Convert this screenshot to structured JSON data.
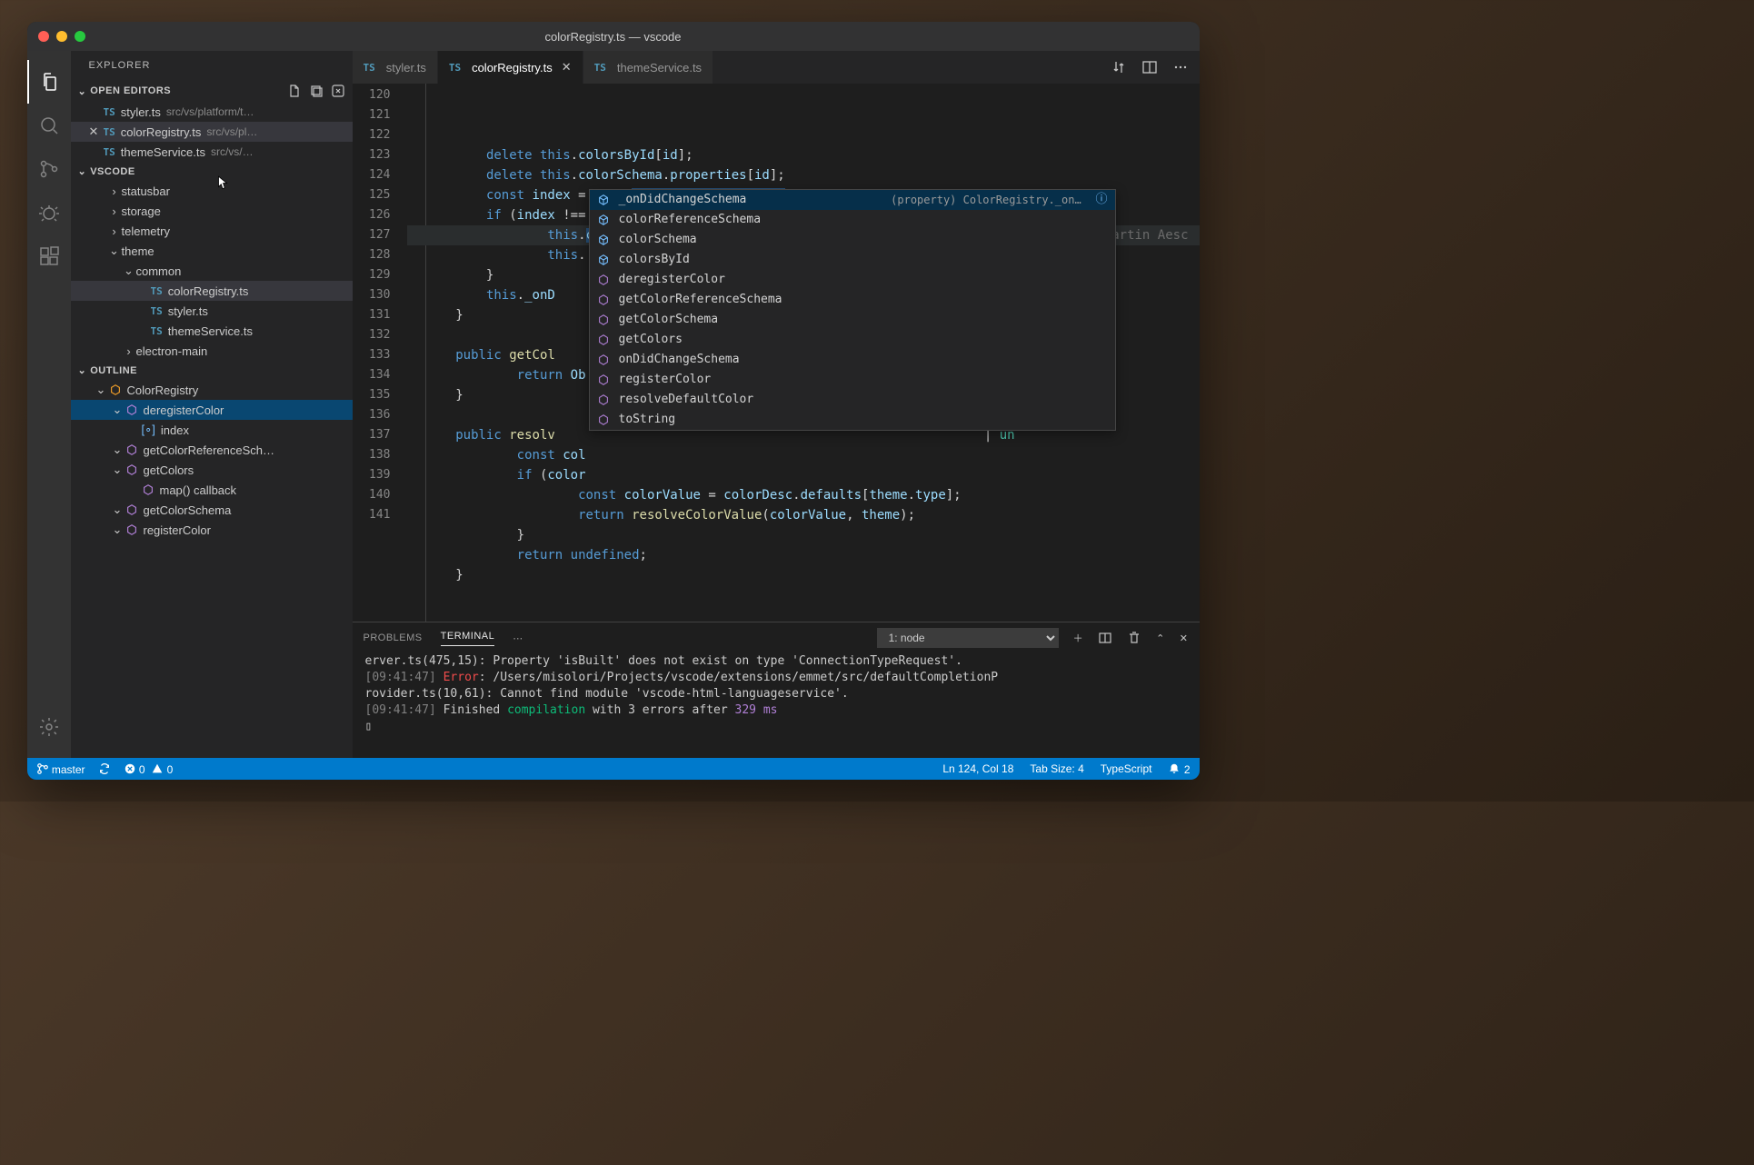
{
  "title": "colorRegistry.ts — vscode",
  "explorer": {
    "title": "EXPLORER"
  },
  "sections": {
    "open_editors": "OPEN EDITORS",
    "workspace": "VSCODE",
    "outline": "OUTLINE"
  },
  "open_editors": [
    {
      "name": "styler.ts",
      "path": "src/vs/platform/t…",
      "active": false
    },
    {
      "name": "colorRegistry.ts",
      "path": "src/vs/pl…",
      "active": true
    },
    {
      "name": "themeService.ts",
      "path": "src/vs/…",
      "active": false
    }
  ],
  "tree": [
    {
      "depth": 2,
      "chev": "›",
      "name": "statusbar"
    },
    {
      "depth": 2,
      "chev": "›",
      "name": "storage"
    },
    {
      "depth": 2,
      "chev": "›",
      "name": "telemetry"
    },
    {
      "depth": 2,
      "chev": "⌄",
      "name": "theme"
    },
    {
      "depth": 3,
      "chev": "⌄",
      "name": "common"
    },
    {
      "depth": 4,
      "chev": "",
      "name": "colorRegistry.ts",
      "ts": true,
      "selected": true
    },
    {
      "depth": 4,
      "chev": "",
      "name": "styler.ts",
      "ts": true
    },
    {
      "depth": 4,
      "chev": "",
      "name": "themeService.ts",
      "ts": true
    },
    {
      "depth": 3,
      "chev": "›",
      "name": "electron-main"
    }
  ],
  "outline_items": [
    {
      "depth": 0,
      "chev": "⌄",
      "kind": "class",
      "name": "ColorRegistry"
    },
    {
      "depth": 1,
      "chev": "⌄",
      "kind": "method",
      "name": "deregisterColor",
      "selected": true
    },
    {
      "depth": 2,
      "chev": "",
      "kind": "var",
      "name": "index"
    },
    {
      "depth": 1,
      "chev": "⌄",
      "kind": "method",
      "name": "getColorReferenceSch…"
    },
    {
      "depth": 1,
      "chev": "⌄",
      "kind": "method",
      "name": "getColors"
    },
    {
      "depth": 2,
      "chev": "",
      "kind": "method",
      "name": "map() callback"
    },
    {
      "depth": 1,
      "chev": "⌄",
      "kind": "method",
      "name": "getColorSchema"
    },
    {
      "depth": 1,
      "chev": "⌄",
      "kind": "method",
      "name": "registerColor"
    }
  ],
  "tabs": [
    {
      "name": "styler.ts",
      "active": false
    },
    {
      "name": "colorRegistry.ts",
      "active": true
    },
    {
      "name": "themeService.ts",
      "active": false
    }
  ],
  "line_start": 120,
  "line_end": 141,
  "code_blame": "Martin Aesc",
  "suggest": {
    "detail": "(property) ColorRegistry._on…",
    "items": [
      {
        "kind": "field",
        "label": "_onDidChangeSchema",
        "selected": true
      },
      {
        "kind": "field",
        "label": "colorReferenceSchema"
      },
      {
        "kind": "field",
        "label": "colorSchema"
      },
      {
        "kind": "field",
        "label": "colorsById"
      },
      {
        "kind": "method",
        "label": "deregisterColor"
      },
      {
        "kind": "method",
        "label": "getColorReferenceSchema"
      },
      {
        "kind": "method",
        "label": "getColorSchema"
      },
      {
        "kind": "method",
        "label": "getColors"
      },
      {
        "kind": "method",
        "label": "onDidChangeSchema"
      },
      {
        "kind": "method",
        "label": "registerColor"
      },
      {
        "kind": "method",
        "label": "resolveDefaultColor"
      },
      {
        "kind": "method",
        "label": "toString"
      }
    ]
  },
  "panel": {
    "tabs": {
      "problems": "PROBLEMS",
      "terminal": "TERMINAL"
    },
    "dropdown": "1: node",
    "terminal_lines": [
      {
        "pre": "erver.ts(475,15): Property 'isBuilt' does not exist on type 'ConnectionTypeRequest'."
      },
      {
        "time": "[09:41:47]",
        "kind": "err",
        "label": "Error",
        "rest": ": /Users/misolori/Projects/vscode/extensions/emmet/src/defaultCompletionP"
      },
      {
        "pre": "rovider.ts(10,61): Cannot find module 'vscode-html-languageservice'."
      },
      {
        "time": "[09:41:47]",
        "rest_a": " Finished ",
        "ok": "compilation",
        "rest_b": " with 3 errors after ",
        "num": "329 ms"
      }
    ]
  },
  "status": {
    "branch": "master",
    "errors": "0",
    "warnings": "0",
    "lncol": "Ln 124, Col 18",
    "tabsize": "Tab Size: 4",
    "lang": "TypeScript",
    "bell": "2"
  }
}
